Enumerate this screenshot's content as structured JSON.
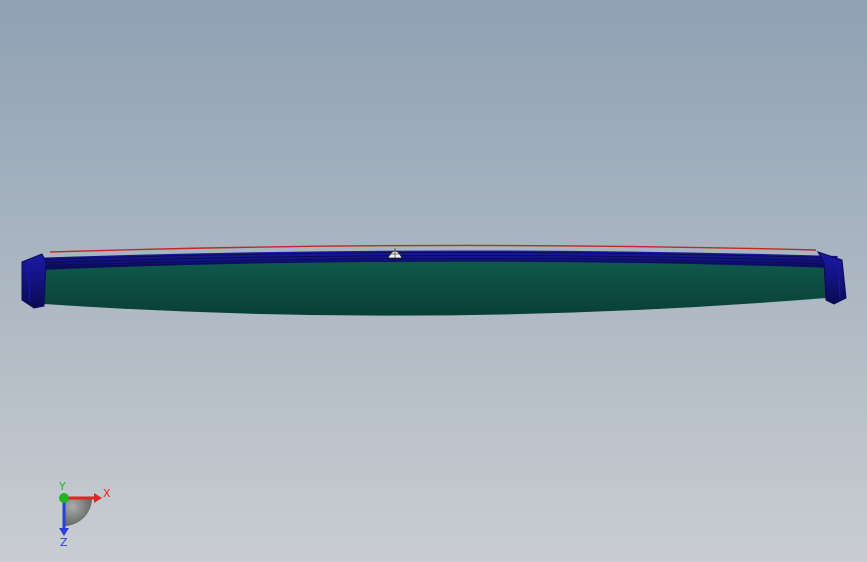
{
  "viewport": {
    "background_top": "#8fa1b4",
    "background_bottom": "#c9cdd1"
  },
  "model": {
    "face_color": "#0f5a4c",
    "face_shade": "#0a3f36",
    "edge_color": "#1a1aa8",
    "edge_dark": "#0b0b55",
    "rim_color": "#c0282a",
    "boss_color": "#f2f2f2"
  },
  "triad": {
    "x_label": "X",
    "y_label": "Y",
    "z_label": "Z",
    "x_color": "#e0261f",
    "y_color": "#22b422",
    "z_color": "#2a3fd8"
  }
}
